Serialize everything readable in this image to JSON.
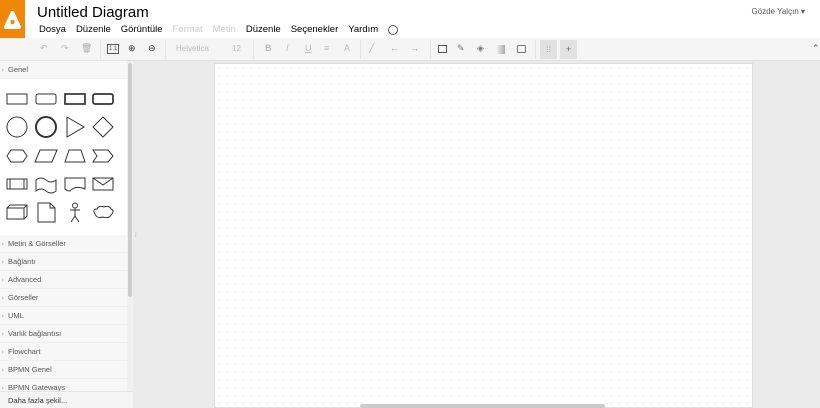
{
  "app": {
    "title": "Untitled Diagram",
    "user": "Gözde Yalçın",
    "brand_color": "#f08705"
  },
  "menu": [
    {
      "label": "Dosya",
      "enabled": true
    },
    {
      "label": "Düzenle",
      "enabled": true
    },
    {
      "label": "Görüntüle",
      "enabled": true
    },
    {
      "label": "Format",
      "enabled": false
    },
    {
      "label": "Metin",
      "enabled": false
    },
    {
      "label": "Düzenle",
      "enabled": true
    },
    {
      "label": "Seçenekler",
      "enabled": true
    },
    {
      "label": "Yardım",
      "enabled": true
    }
  ],
  "toolbar": {
    "font": "Helvetica",
    "size": "12",
    "icons": [
      "undo-icon",
      "redo-icon",
      "delete-icon",
      "actual-size-icon",
      "zoom-in-icon",
      "zoom-out-icon",
      "bold-icon",
      "italic-icon",
      "underline-icon",
      "align-icon",
      "font-color-icon",
      "line-icon",
      "arrow-left-icon",
      "arrow-right-icon",
      "image-icon",
      "line-color-icon",
      "fill-color-icon",
      "gradient-icon",
      "shadow-icon",
      "grid-icon",
      "guides-icon"
    ]
  },
  "sidebar": {
    "genel": "Genel",
    "sections": [
      "Metin & Görseller",
      "Bağlantı",
      "Advanced",
      "Görseller",
      "UML",
      "Varlık bağlantısı",
      "Flowchart",
      "BPMN Genel",
      "BPMN Gateways"
    ],
    "more": "Daha fazla şekil..."
  }
}
